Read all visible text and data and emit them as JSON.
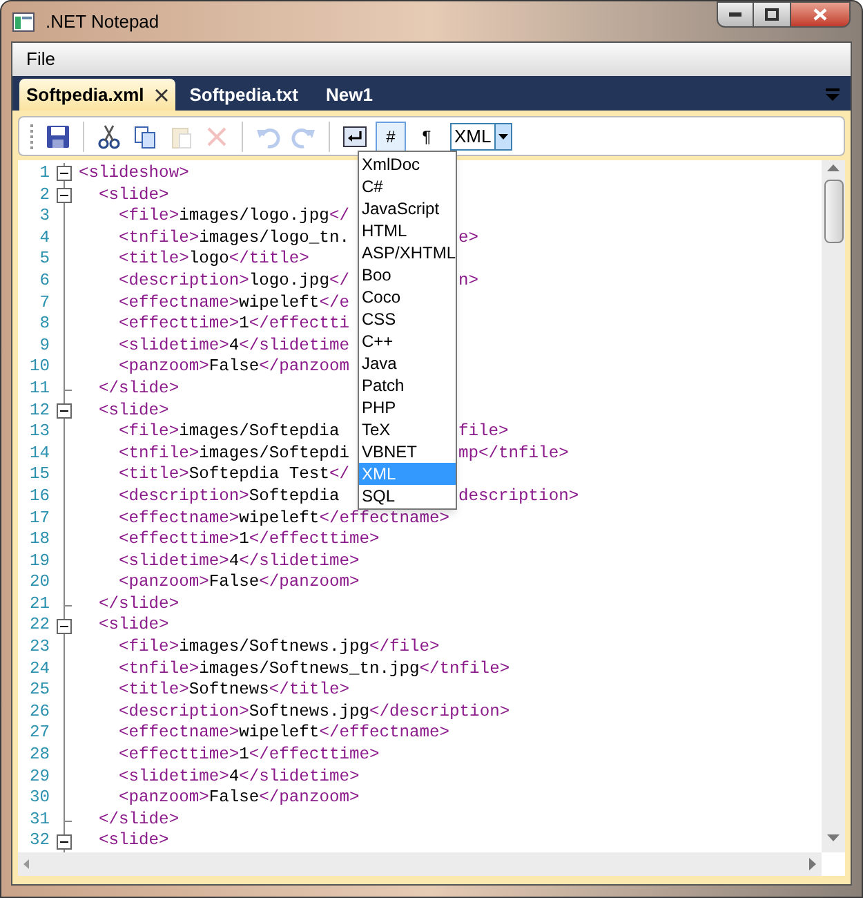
{
  "window": {
    "title": ".NET Notepad"
  },
  "menu": [
    "File"
  ],
  "tabs": [
    {
      "label": "Softpedia.xml",
      "selected": true,
      "closable": true
    },
    {
      "label": "Softpedia.txt",
      "selected": false,
      "closable": false
    },
    {
      "label": "New1",
      "selected": false,
      "closable": false
    }
  ],
  "toolbar": [
    {
      "kind": "save",
      "disabled": false
    },
    {
      "kind": "separator"
    },
    {
      "kind": "cut",
      "disabled": false
    },
    {
      "kind": "copy",
      "disabled": false
    },
    {
      "kind": "paste",
      "disabled": true
    },
    {
      "kind": "delete",
      "disabled": true
    },
    {
      "kind": "separator"
    },
    {
      "kind": "undo",
      "disabled": true
    },
    {
      "kind": "redo",
      "disabled": true
    },
    {
      "kind": "separator"
    },
    {
      "kind": "wrap",
      "disabled": false
    },
    {
      "kind": "toggle",
      "label": "#",
      "selected": true
    },
    {
      "kind": "toggle",
      "label": "¶",
      "selected": false
    }
  ],
  "language": {
    "value": "XML",
    "expanded": true,
    "options": [
      {
        "label": "XmlDoc",
        "selected": false
      },
      {
        "label": "C#",
        "selected": false
      },
      {
        "label": "JavaScript",
        "selected": false
      },
      {
        "label": "HTML",
        "selected": false
      },
      {
        "label": "ASP/XHTML",
        "selected": false
      },
      {
        "label": "Boo",
        "selected": false
      },
      {
        "label": "Coco",
        "selected": false
      },
      {
        "label": "CSS",
        "selected": false
      },
      {
        "label": "C++",
        "selected": false
      },
      {
        "label": "Java",
        "selected": false
      },
      {
        "label": "Patch",
        "selected": false
      },
      {
        "label": "PHP",
        "selected": false
      },
      {
        "label": "TeX",
        "selected": false
      },
      {
        "label": "VBNET",
        "selected": false
      },
      {
        "label": "XML",
        "selected": true
      },
      {
        "label": "SQL",
        "selected": false
      }
    ]
  },
  "editor": {
    "lines": [
      {
        "number": "1",
        "kind": "open",
        "text": "<slideshow>"
      },
      {
        "number": "2",
        "kind": "open",
        "text": "  <slide>"
      },
      {
        "number": "3",
        "kind": "inner",
        "text": "    <file>images/logo.jpg</"
      },
      {
        "number": "4",
        "kind": "inner",
        "text": "    <tnfile>images/logo_tn.",
        "tail": "e>"
      },
      {
        "number": "5",
        "kind": "inner",
        "text": "    <title>logo</title>"
      },
      {
        "number": "6",
        "kind": "inner",
        "text": "    <description>logo.jpg</",
        "tail": "n>"
      },
      {
        "number": "7",
        "kind": "inner",
        "text": "    <effectname>wipeleft</e"
      },
      {
        "number": "8",
        "kind": "inner",
        "text": "    <effecttime>1</effectti"
      },
      {
        "number": "9",
        "kind": "inner",
        "text": "    <slidetime>4</slidetime"
      },
      {
        "number": "10",
        "kind": "inner",
        "text": "    <panzoom>False</panzoom"
      },
      {
        "number": "11",
        "kind": "end",
        "text": "  </slide>"
      },
      {
        "number": "12",
        "kind": "open",
        "text": "  <slide>"
      },
      {
        "number": "13",
        "kind": "inner",
        "text": "    <file>images/Softepdia",
        "tail": "file>"
      },
      {
        "number": "14",
        "kind": "inner",
        "text": "    <tnfile>images/Softepdi",
        "tail": "mp</tnfile>"
      },
      {
        "number": "15",
        "kind": "inner",
        "text": "    <title>Softepdia Test</"
      },
      {
        "number": "16",
        "kind": "inner",
        "text": "    <description>Softepdia",
        "tail": "description>"
      },
      {
        "number": "17",
        "kind": "inner",
        "text": "    <effectname>wipeleft</effectname>"
      },
      {
        "number": "18",
        "kind": "inner",
        "text": "    <effecttime>1</effecttime>"
      },
      {
        "number": "19",
        "kind": "inner",
        "text": "    <slidetime>4</slidetime>"
      },
      {
        "number": "20",
        "kind": "inner",
        "text": "    <panzoom>False</panzoom>"
      },
      {
        "number": "21",
        "kind": "end",
        "text": "  </slide>"
      },
      {
        "number": "22",
        "kind": "open",
        "text": "  <slide>"
      },
      {
        "number": "23",
        "kind": "inner",
        "text": "    <file>images/Softnews.jpg</file>"
      },
      {
        "number": "24",
        "kind": "inner",
        "text": "    <tnfile>images/Softnews_tn.jpg</tnfile>"
      },
      {
        "number": "25",
        "kind": "inner",
        "text": "    <title>Softnews</title>"
      },
      {
        "number": "26",
        "kind": "inner",
        "text": "    <description>Softnews.jpg</description>"
      },
      {
        "number": "27",
        "kind": "inner",
        "text": "    <effectname>wipeleft</effectname>"
      },
      {
        "number": "28",
        "kind": "inner",
        "text": "    <effecttime>1</effecttime>"
      },
      {
        "number": "29",
        "kind": "inner",
        "text": "    <slidetime>4</slidetime>"
      },
      {
        "number": "30",
        "kind": "inner",
        "text": "    <panzoom>False</panzoom>"
      },
      {
        "number": "31",
        "kind": "end",
        "text": "  </slide>"
      },
      {
        "number": "32",
        "kind": "open",
        "text": "  <slide>"
      }
    ]
  }
}
